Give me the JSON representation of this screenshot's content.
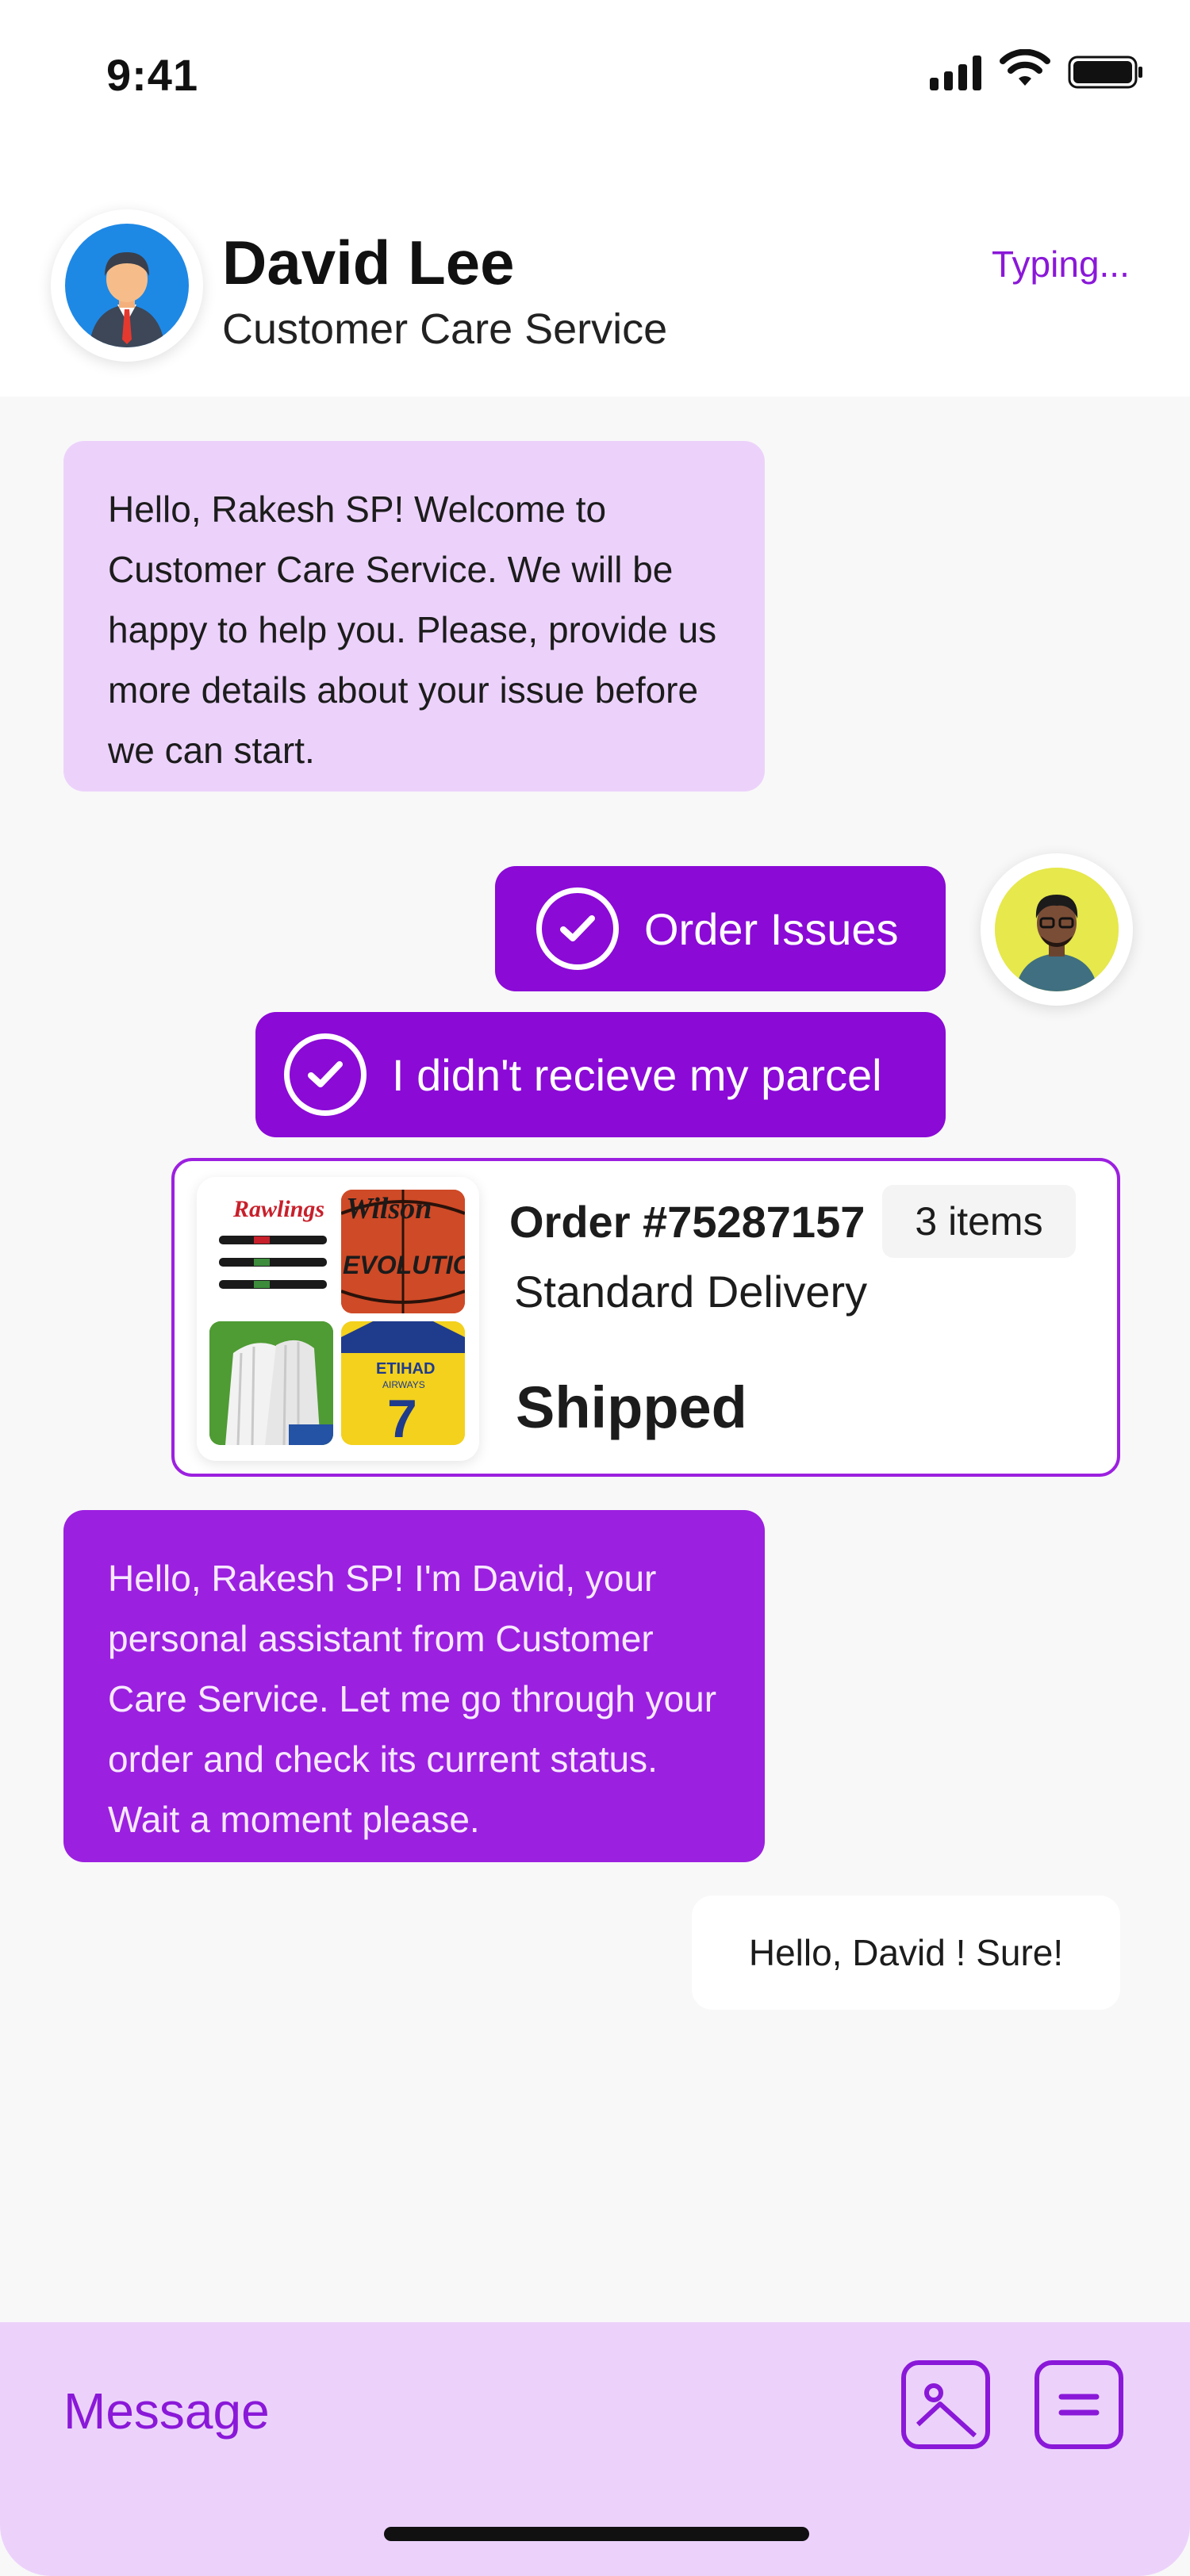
{
  "status_bar": {
    "time": "9:41",
    "icons": [
      "cellular-signal-icon",
      "wifi-icon",
      "battery-icon"
    ]
  },
  "header": {
    "agent_name": "David Lee",
    "agent_role": "Customer Care Service",
    "typing_status": "Typing..."
  },
  "messages": [
    {
      "direction": "incoming",
      "text": "Hello, Rakesh SP! Welcome to Customer Care Service. We will be happy to help you. Please, provide us more details about your issue before we can start."
    },
    {
      "direction": "outgoing",
      "text": "Order Issues",
      "icon": "check-circle-icon"
    },
    {
      "direction": "outgoing",
      "text": "I didn't recieve my parcel",
      "icon": "check-circle-icon"
    },
    {
      "direction": "outgoing",
      "type": "order_card",
      "order_number": "Order #75287157",
      "items_count": "3 items",
      "delivery_type": "Standard Delivery",
      "status": "Shipped",
      "thumbnails": [
        "bats-thumbnail",
        "basketball-thumbnail",
        "gloves-thumbnail",
        "jersey-thumbnail"
      ]
    },
    {
      "direction": "incoming",
      "text": "Hello, Rakesh SP! I'm David, your personal assistant from Customer Care Service. Let me go through your order and check its current status. Wait a moment please."
    },
    {
      "direction": "outgoing",
      "text": "Hello, David ! Sure!"
    }
  ],
  "composer": {
    "placeholder": "Message",
    "icons": [
      "image-icon",
      "menu-icon"
    ]
  },
  "colors": {
    "accent": "#8b0ad6",
    "accent_light": "#ecd2fb",
    "incoming_purple": "#9c20e0",
    "background": "#f8f8f8"
  }
}
